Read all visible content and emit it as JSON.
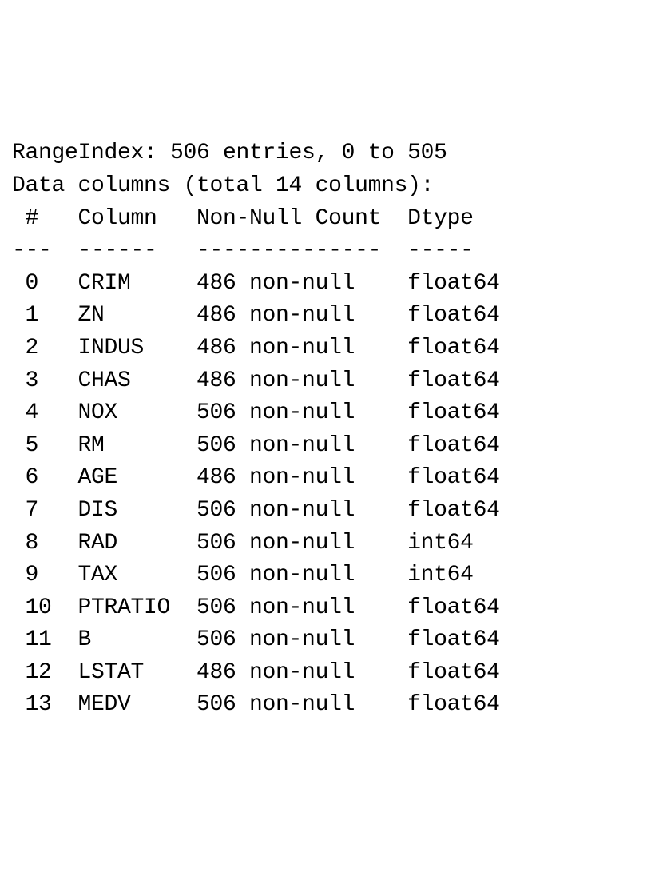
{
  "line_range": "RangeIndex: 506 entries, 0 to 505",
  "line_cols": "Data columns (total 14 columns):",
  "header": {
    "idx": " #   Column   Non-Null Count  Dtype  ",
    "sep": "---  ------   --------------  -----  "
  },
  "rows": [
    " 0   CRIM     486 non-null    float64",
    " 1   ZN       486 non-null    float64",
    " 2   INDUS    486 non-null    float64",
    " 3   CHAS     486 non-null    float64",
    " 4   NOX      506 non-null    float64",
    " 5   RM       506 non-null    float64",
    " 6   AGE      486 non-null    float64",
    " 7   DIS      506 non-null    float64",
    " 8   RAD      506 non-null    int64  ",
    " 9   TAX      506 non-null    int64  ",
    " 10  PTRATIO  506 non-null    float64",
    " 11  B        506 non-null    float64",
    " 12  LSTAT    486 non-null    float64",
    " 13  MEDV     506 non-null    float64"
  ],
  "info_data": {
    "range_index": {
      "entries": 506,
      "start": 0,
      "stop": 505
    },
    "total_columns": 14,
    "columns": [
      {
        "index": 0,
        "name": "CRIM",
        "non_null": 486,
        "dtype": "float64"
      },
      {
        "index": 1,
        "name": "ZN",
        "non_null": 486,
        "dtype": "float64"
      },
      {
        "index": 2,
        "name": "INDUS",
        "non_null": 486,
        "dtype": "float64"
      },
      {
        "index": 3,
        "name": "CHAS",
        "non_null": 486,
        "dtype": "float64"
      },
      {
        "index": 4,
        "name": "NOX",
        "non_null": 506,
        "dtype": "float64"
      },
      {
        "index": 5,
        "name": "RM",
        "non_null": 506,
        "dtype": "float64"
      },
      {
        "index": 6,
        "name": "AGE",
        "non_null": 486,
        "dtype": "float64"
      },
      {
        "index": 7,
        "name": "DIS",
        "non_null": 506,
        "dtype": "float64"
      },
      {
        "index": 8,
        "name": "RAD",
        "non_null": 506,
        "dtype": "int64"
      },
      {
        "index": 9,
        "name": "TAX",
        "non_null": 506,
        "dtype": "int64"
      },
      {
        "index": 10,
        "name": "PTRATIO",
        "non_null": 506,
        "dtype": "float64"
      },
      {
        "index": 11,
        "name": "B",
        "non_null": 506,
        "dtype": "float64"
      },
      {
        "index": 12,
        "name": "LSTAT",
        "non_null": 486,
        "dtype": "float64"
      },
      {
        "index": 13,
        "name": "MEDV",
        "non_null": 506,
        "dtype": "float64"
      }
    ]
  }
}
